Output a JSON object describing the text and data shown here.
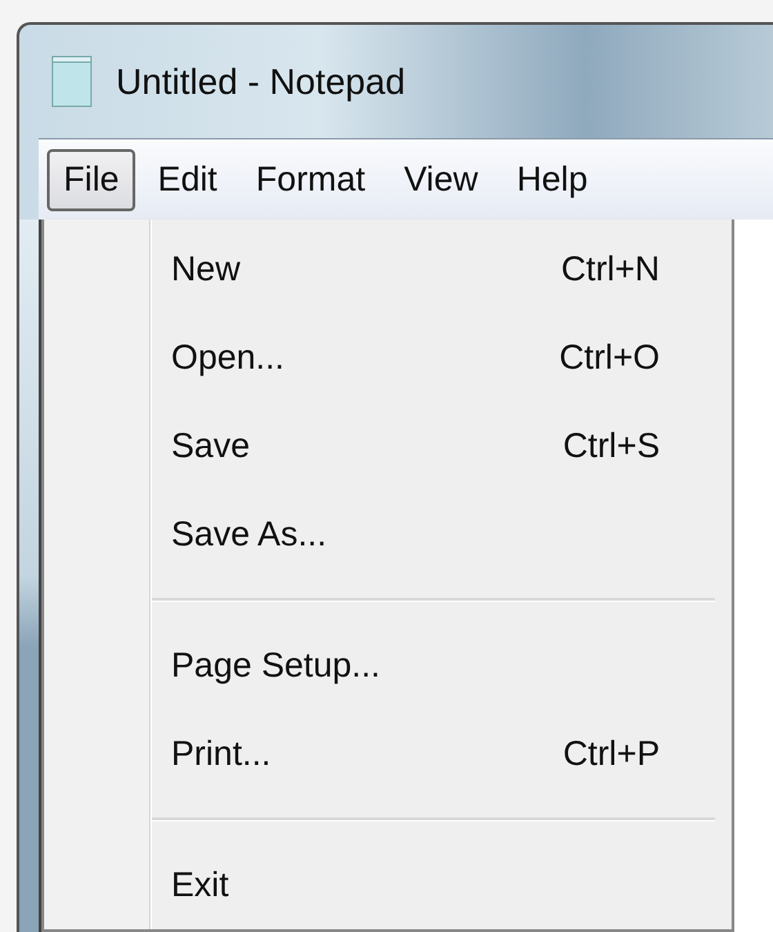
{
  "window": {
    "title": "Untitled - Notepad"
  },
  "menu_bar": [
    {
      "label": "File",
      "selected": true
    },
    {
      "label": "Edit",
      "selected": false
    },
    {
      "label": "Format",
      "selected": false
    },
    {
      "label": "View",
      "selected": false
    },
    {
      "label": "Help",
      "selected": false
    }
  ],
  "file_menu": [
    {
      "kind": "item",
      "label": "New",
      "shortcut": "Ctrl+N"
    },
    {
      "kind": "item",
      "label": "Open...",
      "shortcut": "Ctrl+O"
    },
    {
      "kind": "item",
      "label": "Save",
      "shortcut": "Ctrl+S"
    },
    {
      "kind": "item",
      "label": "Save As..."
    },
    {
      "kind": "separator"
    },
    {
      "kind": "item",
      "label": "Page Setup..."
    },
    {
      "kind": "item",
      "label": "Print...",
      "shortcut": "Ctrl+P"
    },
    {
      "kind": "separator"
    },
    {
      "kind": "item",
      "label": "Exit"
    }
  ]
}
